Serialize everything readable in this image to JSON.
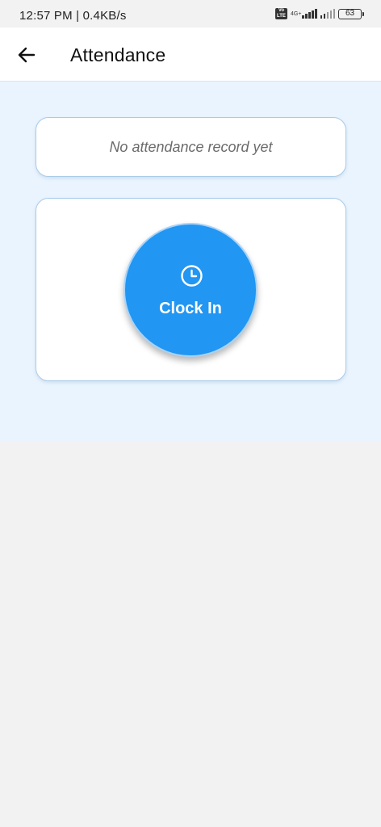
{
  "status_bar": {
    "time": "12:57 PM | 0.4KB/s",
    "volte_label": "Vo LTE",
    "network_type": "4G+",
    "battery": "63"
  },
  "app_bar": {
    "back_icon": "arrow-left-icon",
    "title": "Attendance"
  },
  "attendance": {
    "empty_message": "No attendance record yet",
    "clock_icon": "clock-icon",
    "clock_in_label": "Clock In"
  },
  "colors": {
    "accent": "#2196f3",
    "content_bg": "#eaf4fe",
    "card_border": "#a9cbe8",
    "page_bg": "#f2f2f2"
  }
}
